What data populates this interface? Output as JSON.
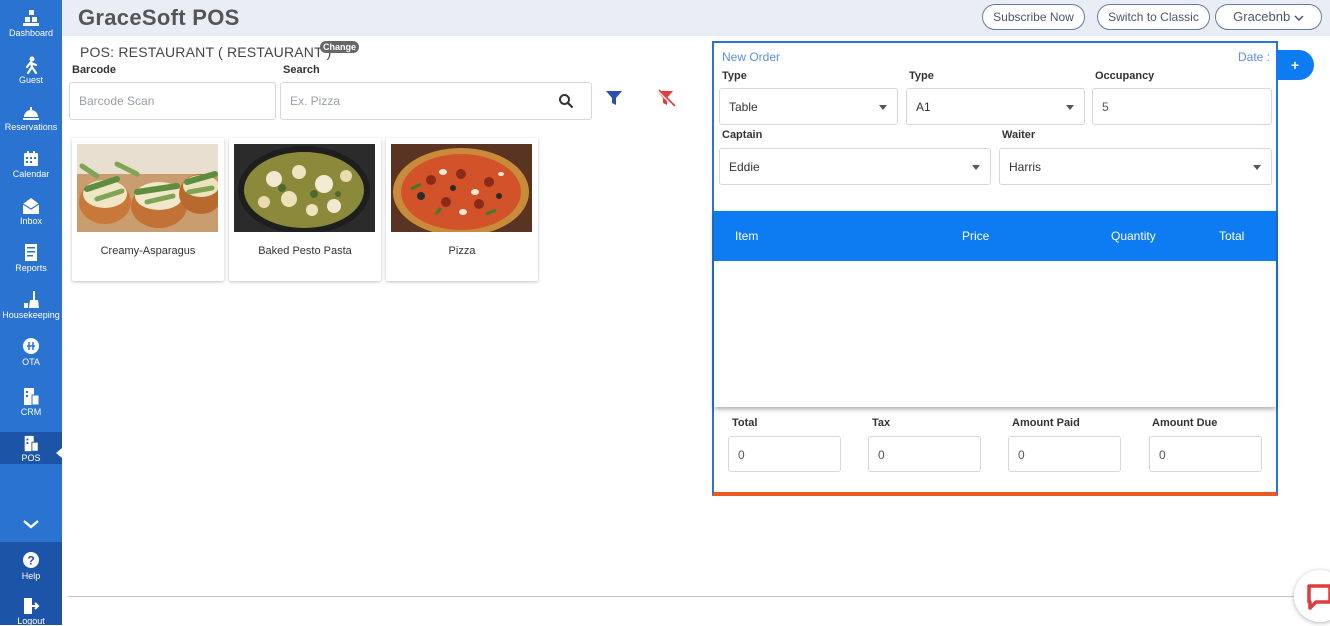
{
  "app_title": "GraceSoft POS",
  "header": {
    "subscribe_label": "Subscribe Now",
    "classic_label": "Switch to Classic",
    "user_label": "Gracebnb"
  },
  "sidebar": {
    "items": [
      {
        "label": "Dashboard",
        "icon": "dashboard-icon"
      },
      {
        "label": "Guest",
        "icon": "guest-icon"
      },
      {
        "label": "Reservations",
        "icon": "reservations-icon"
      },
      {
        "label": "Calendar",
        "icon": "calendar-icon"
      },
      {
        "label": "Inbox",
        "icon": "inbox-icon"
      },
      {
        "label": "Reports",
        "icon": "reports-icon"
      },
      {
        "label": "Housekeeping",
        "icon": "housekeeping-icon"
      },
      {
        "label": "OTA",
        "icon": "ota-icon"
      },
      {
        "label": "CRM",
        "icon": "crm-icon"
      },
      {
        "label": "POS",
        "icon": "pos-icon"
      }
    ],
    "help_label": "Help",
    "logout_label": "Logout"
  },
  "pos": {
    "title": "POS: RESTAURANT ( RESTAURANT )",
    "change_label": "Change",
    "barcode_label": "Barcode",
    "barcode_placeholder": "Barcode Scan",
    "search_label": "Search",
    "search_placeholder": "Ex. Pizza"
  },
  "products": [
    {
      "name": "Creamy-Asparagus"
    },
    {
      "name": "Baked Pesto Pasta"
    },
    {
      "name": "Pizza"
    }
  ],
  "order": {
    "heading": "New Order",
    "date_label": "Date :",
    "type1_label": "Type",
    "type1_value": "Table",
    "type2_label": "Type",
    "type2_value": "A1",
    "occupancy_label": "Occupancy",
    "occupancy_value": "5",
    "captain_label": "Captain",
    "captain_value": "Eddie",
    "waiter_label": "Waiter",
    "waiter_value": "Harris",
    "columns": [
      "Item",
      "Price",
      "Quantity",
      "Total"
    ],
    "total_label": "Total",
    "total_value": "0",
    "tax_label": "Tax",
    "tax_value": "0",
    "paid_label": "Amount Paid",
    "paid_value": "0",
    "due_label": "Amount Due",
    "due_value": "0",
    "add_button": "+"
  },
  "colors": {
    "sidebar": "#2a73d0",
    "accent": "#0d7cf2",
    "order_border_bottom": "#e85a20"
  }
}
